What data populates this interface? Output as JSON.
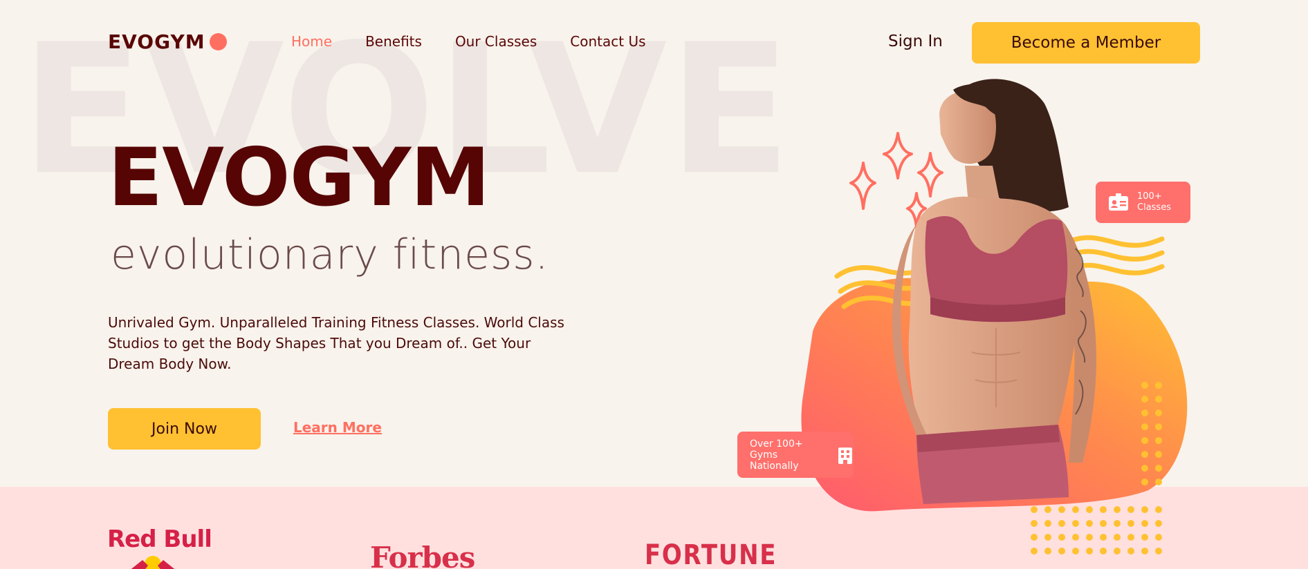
{
  "watermark": "EVOLVE",
  "nav": {
    "logo_text": "EVOGYM",
    "links": [
      "Home",
      "Benefits",
      "Our Classes",
      "Contact Us"
    ],
    "sign_in": "Sign In",
    "member_button": "Become a Member"
  },
  "hero": {
    "title": "EVOGYM",
    "subtitle": "evolutionary fitness.",
    "description": "Unrivaled Gym. Unparalleled Training Fitness Classes. World Class Studios to get the Body Shapes That you Dream of.. Get Your Dream Body Now.",
    "join_button": "Join Now",
    "learn_more": "Learn More"
  },
  "badges": {
    "classes_line1": "100+",
    "classes_line2": "Classes",
    "classes_icon": "id-card-icon",
    "gyms_line1": "Over 100+",
    "gyms_line2": "Gyms Nationally",
    "gyms_icon": "building-icon"
  },
  "sponsors": [
    "Red Bull",
    "Forbes",
    "FORTUNE"
  ],
  "colors": {
    "background": "#f8f3ec",
    "primary_dark": "#560404",
    "accent_coral": "#ff6f61",
    "accent_yellow": "#ffc132",
    "sponsor_band": "#ffe0df"
  }
}
